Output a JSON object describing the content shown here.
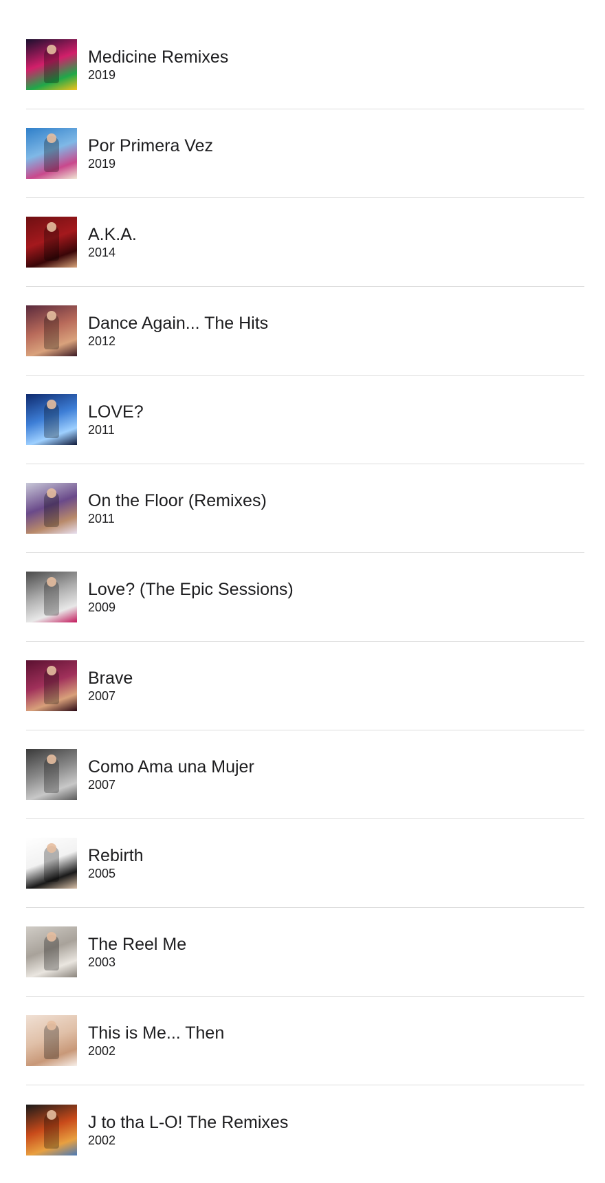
{
  "albums": [
    {
      "title": "Medicine Remixes",
      "year": "2019",
      "art_icon": "album-art-medicine-remixes",
      "colors": [
        "#1a0f2e",
        "#d21f6a",
        "#1fa84a",
        "#f2c21b"
      ]
    },
    {
      "title": "Por Primera Vez",
      "year": "2019",
      "art_icon": "album-art-por-primera-vez",
      "colors": [
        "#2f7fc9",
        "#7fb8e6",
        "#c9488c",
        "#f0e6d4"
      ]
    },
    {
      "title": "A.K.A.",
      "year": "2014",
      "art_icon": "album-art-aka",
      "colors": [
        "#6e0f12",
        "#a4191d",
        "#3a0608",
        "#d8a47a"
      ]
    },
    {
      "title": "Dance Again... The Hits",
      "year": "2012",
      "art_icon": "album-art-dance-again",
      "colors": [
        "#5a2a3c",
        "#b86a5a",
        "#d9a27c",
        "#3b1a24"
      ]
    },
    {
      "title": "LOVE?",
      "year": "2011",
      "art_icon": "album-art-love",
      "colors": [
        "#0e2a6e",
        "#3d7ed6",
        "#9ed0ff",
        "#101a3a"
      ]
    },
    {
      "title": "On the Floor (Remixes)",
      "year": "2011",
      "art_icon": "album-art-on-the-floor",
      "colors": [
        "#c8c8d8",
        "#6a4a8a",
        "#b98a6a",
        "#e8e0f0"
      ]
    },
    {
      "title": "Love? (The Epic Sessions)",
      "year": "2009",
      "art_icon": "album-art-love-epic-sessions",
      "colors": [
        "#4a4a4a",
        "#b0b0b0",
        "#e8e8e8",
        "#c2185b"
      ]
    },
    {
      "title": "Brave",
      "year": "2007",
      "art_icon": "album-art-brave",
      "colors": [
        "#5a1030",
        "#a0305a",
        "#d8a07a",
        "#2a0814"
      ]
    },
    {
      "title": "Como Ama una Mujer",
      "year": "2007",
      "art_icon": "album-art-como-ama-una-mujer",
      "colors": [
        "#3a3a3a",
        "#8a8a8a",
        "#c8c8c8",
        "#5a5a5a"
      ]
    },
    {
      "title": "Rebirth",
      "year": "2005",
      "art_icon": "album-art-rebirth",
      "colors": [
        "#ffffff",
        "#f2f2f2",
        "#1a1a1a",
        "#d8c0a8"
      ]
    },
    {
      "title": "The Reel Me",
      "year": "2003",
      "art_icon": "album-art-the-reel-me",
      "colors": [
        "#d0ccc6",
        "#a8a29a",
        "#eae6e0",
        "#8a847c"
      ]
    },
    {
      "title": "This is Me... Then",
      "year": "2002",
      "art_icon": "album-art-this-is-me-then",
      "colors": [
        "#f0e0d4",
        "#e0c0a8",
        "#c89878",
        "#f8f0ea"
      ]
    },
    {
      "title": "J to tha L-O! The Remixes",
      "year": "2002",
      "art_icon": "album-art-j-to-tha-lo",
      "colors": [
        "#1a1a1a",
        "#c84a1a",
        "#e8a040",
        "#4a7ab8"
      ]
    }
  ]
}
